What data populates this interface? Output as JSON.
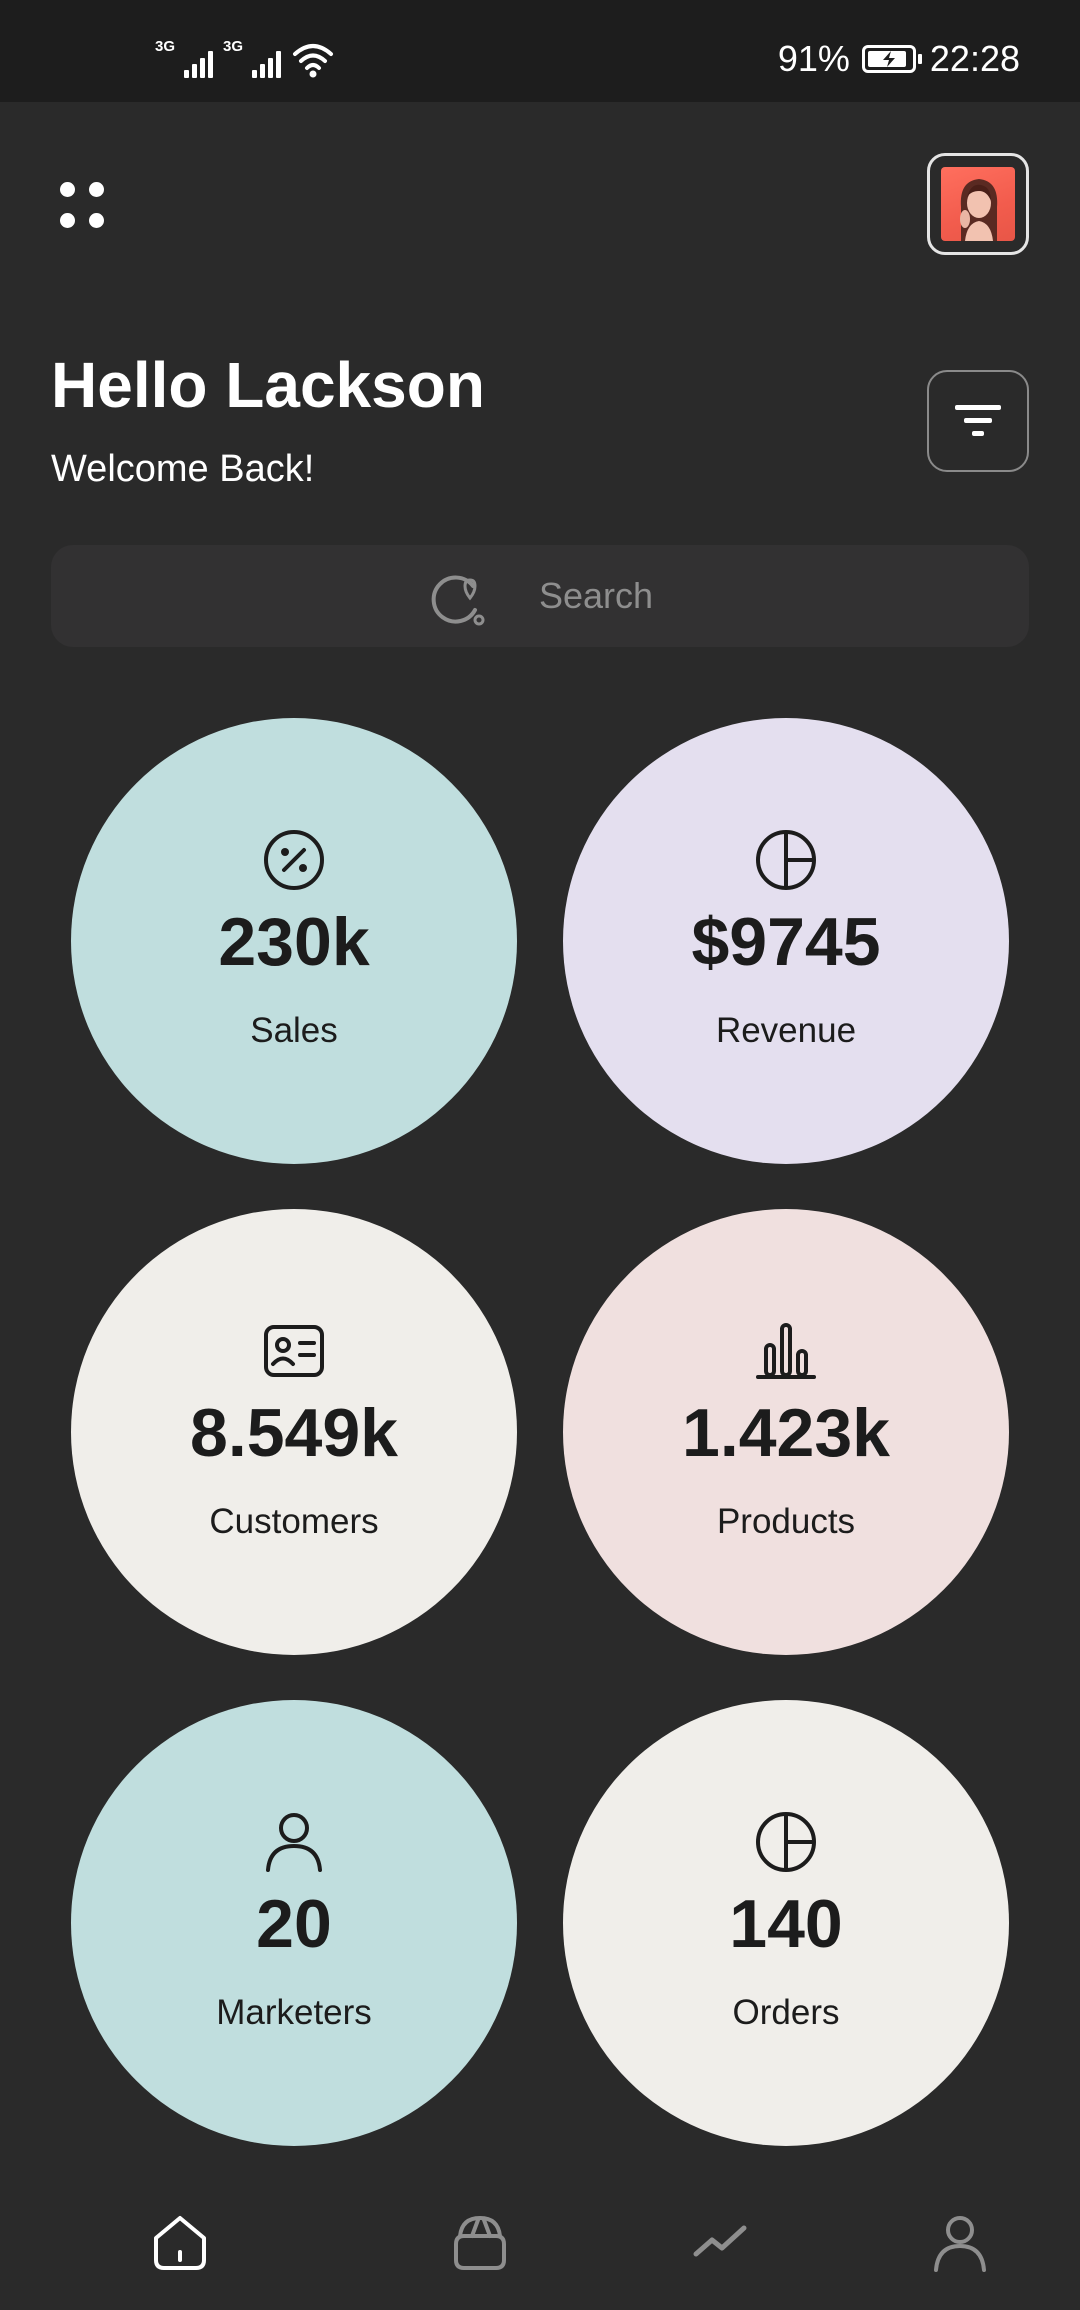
{
  "status_bar": {
    "network_1": "3G",
    "network_2": "3G",
    "battery_percent": "91%",
    "battery_level": 0.91,
    "time": "22:28"
  },
  "header": {
    "menu_icon": "grid-dots-icon",
    "avatar_icon": "profile-avatar"
  },
  "greeting": {
    "title": "Hello Lackson",
    "subtitle": "Welcome Back!",
    "filter_icon": "filter-icon"
  },
  "search": {
    "placeholder": "Search",
    "icon": "search-icon"
  },
  "stats": [
    {
      "value": "230k",
      "label": "Sales",
      "icon": "percent-icon",
      "color": "#c0dede"
    },
    {
      "value": "$9745",
      "label": "Revenue",
      "icon": "pie-chart-icon",
      "color": "#e4dfef"
    },
    {
      "value": "8.549k",
      "label": "Customers",
      "icon": "id-card-icon",
      "color": "#f0eeea"
    },
    {
      "value": "1.423k",
      "label": "Products",
      "icon": "bar-chart-icon",
      "color": "#f0e0df"
    },
    {
      "value": "20",
      "label": "Marketers",
      "icon": "user-icon",
      "color": "#c0dede"
    },
    {
      "value": "140",
      "label": "Orders",
      "icon": "pie-chart-icon",
      "color": "#f0eeea"
    }
  ],
  "bottom_nav": [
    {
      "name": "home",
      "icon": "home-icon",
      "active": true
    },
    {
      "name": "shop",
      "icon": "bag-icon",
      "active": false
    },
    {
      "name": "analytics",
      "icon": "trend-icon",
      "active": false
    },
    {
      "name": "profile",
      "icon": "user-icon",
      "active": false
    }
  ],
  "colors": {
    "background": "#2a2a2a",
    "status_bar": "#1d1d1d",
    "search_bg": "#323132",
    "nav_active": "#ffffff",
    "nav_inactive": "#8e8e8e"
  }
}
